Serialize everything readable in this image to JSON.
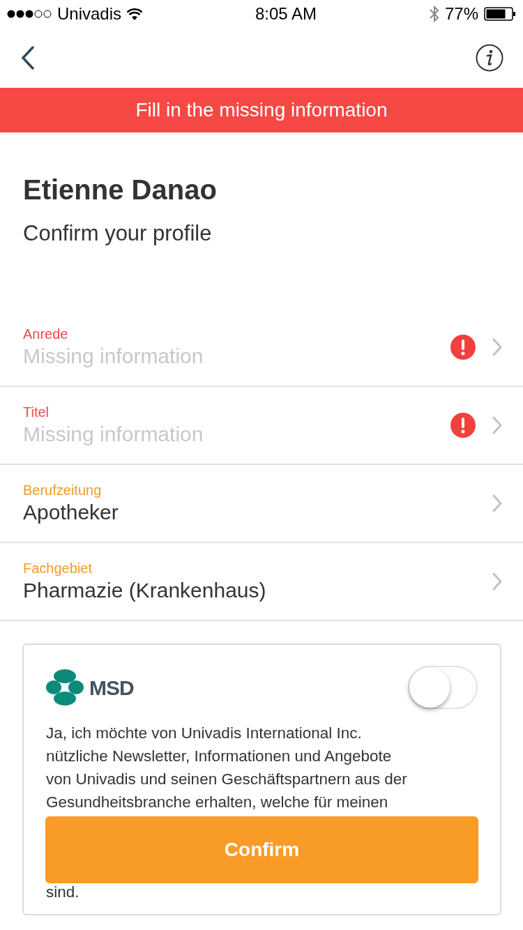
{
  "status_bar": {
    "carrier": "Univadis",
    "time": "8:05 AM",
    "battery": "77%"
  },
  "banner": "Fill in the missing information",
  "header": {
    "name": "Etienne Danao",
    "subtitle": "Confirm your profile"
  },
  "fields": [
    {
      "label": "Anrede",
      "placeholder": "Missing information",
      "missing": true
    },
    {
      "label": "Titel",
      "placeholder": "Missing information",
      "missing": true
    },
    {
      "label": "Berufzeitung",
      "value": "Apotheker",
      "missing": false
    },
    {
      "label": "Fachgebiet",
      "value": "Pharmazie (Krankenhaus)",
      "missing": false
    }
  ],
  "consent": {
    "logo_text": "MSD",
    "on": false,
    "text_lines": [
      "Ja, ich möchte von Univadis International Inc.",
      "nützliche Newsletter, Informationen und Angebote",
      "von Univadis und seinen Geschäftspartnern aus der",
      "Gesundheitsbranche erhalten, welche für meinen"
    ],
    "tail": "sind."
  },
  "confirm_button": "Confirm"
}
